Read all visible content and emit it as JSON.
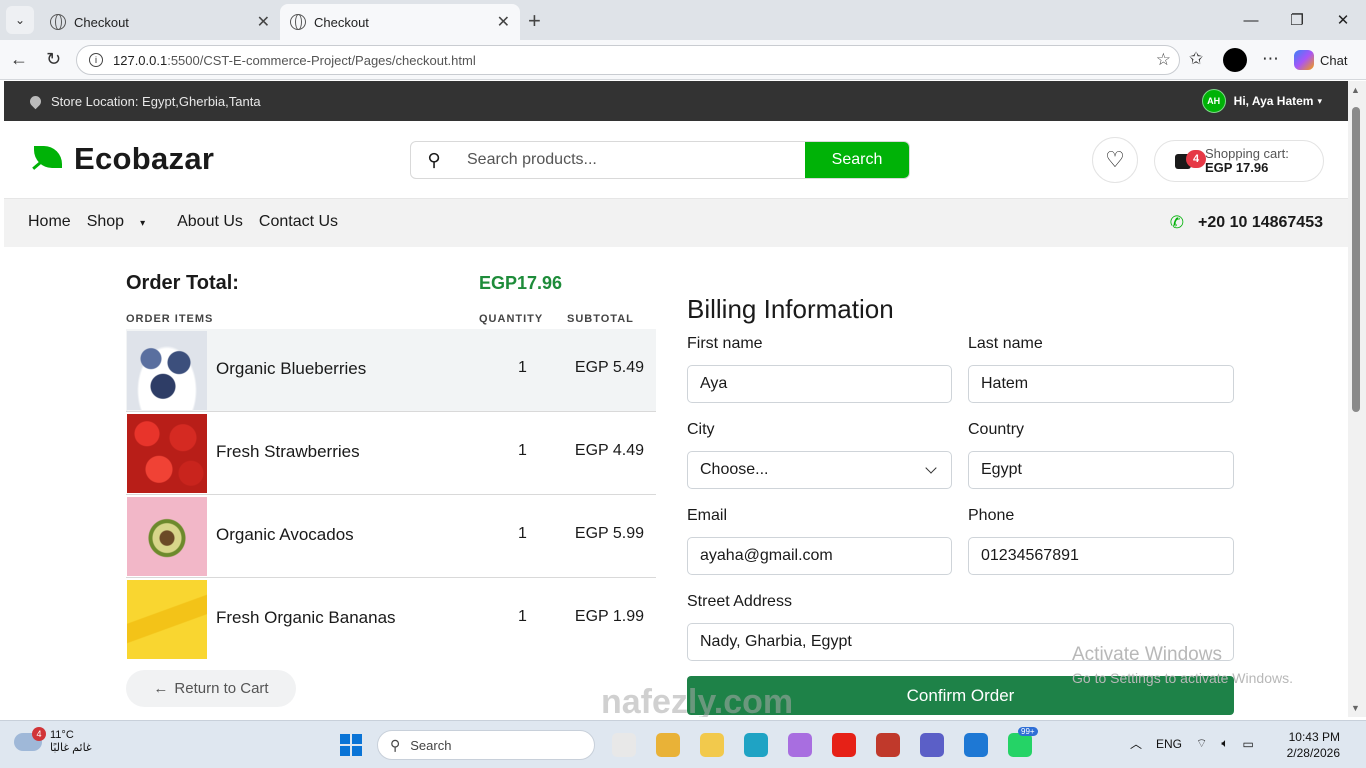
{
  "browser": {
    "tabs": [
      {
        "label": "Checkout",
        "active": false
      },
      {
        "label": "Checkout",
        "active": true
      }
    ],
    "url_host": "127.0.0.1",
    "url_rest": ":5500/CST-E-commerce-Project/Pages/checkout.html",
    "chat_label": "Chat"
  },
  "topbar": {
    "location": "Store Location: Egypt,Gherbia,Tanta",
    "avatar_initials": "AH",
    "greeting": "Hi, Aya Hatem"
  },
  "header": {
    "logo": "Ecobazar",
    "search_placeholder": "Search products...",
    "search_button": "Search",
    "cart_label": "Shopping cart:",
    "cart_total": "EGP 17.96",
    "cart_count": "4"
  },
  "nav": {
    "links": [
      "Home",
      "Shop",
      "About Us",
      "Contact Us"
    ],
    "phone": "+20 10 14867453"
  },
  "order": {
    "total_label": "Order Total:",
    "total_value": "EGP17.96",
    "col_items": "ORDER ITEMS",
    "col_qty": "QUANTITY",
    "col_sub": "SUBTOTAL",
    "items": [
      {
        "name": "Organic Blueberries",
        "qty": "1",
        "subtotal": "EGP 5.49"
      },
      {
        "name": "Fresh Strawberries",
        "qty": "1",
        "subtotal": "EGP 4.49"
      },
      {
        "name": "Organic Avocados",
        "qty": "1",
        "subtotal": "EGP 5.99"
      },
      {
        "name": "Fresh Organic Bananas",
        "qty": "1",
        "subtotal": "EGP 1.99"
      }
    ],
    "return_label": "Return to Cart"
  },
  "billing": {
    "title": "Billing Information",
    "first_name_label": "First name",
    "first_name": "Aya",
    "last_name_label": "Last name",
    "last_name": "Hatem",
    "city_label": "City",
    "city": "Choose...",
    "country_label": "Country",
    "country": "Egypt",
    "email_label": "Email",
    "email": "ayaha@gmail.com",
    "phone_label": "Phone",
    "phone": "01234567891",
    "street_label": "Street Address",
    "street": "Nady, Gharbia, Egypt",
    "confirm_label": "Confirm Order"
  },
  "overlay": {
    "activate_title": "Activate Windows",
    "activate_sub": "Go to Settings to activate Windows.",
    "watermark": "nafezly.com"
  },
  "taskbar": {
    "temp": "11°C",
    "weather_text": "غائم غالبًا",
    "weather_badge": "4",
    "search_label": "Search",
    "lang": "ENG",
    "time": "10:43 PM",
    "date": "2/28/2026",
    "whatsapp_badge": "99+"
  },
  "colors": {
    "brand_green": "#00b207",
    "confirm_green": "#1e8248",
    "total_green": "#1e8c3a",
    "topbar_bg": "#333333",
    "badge_red": "#e63946"
  }
}
